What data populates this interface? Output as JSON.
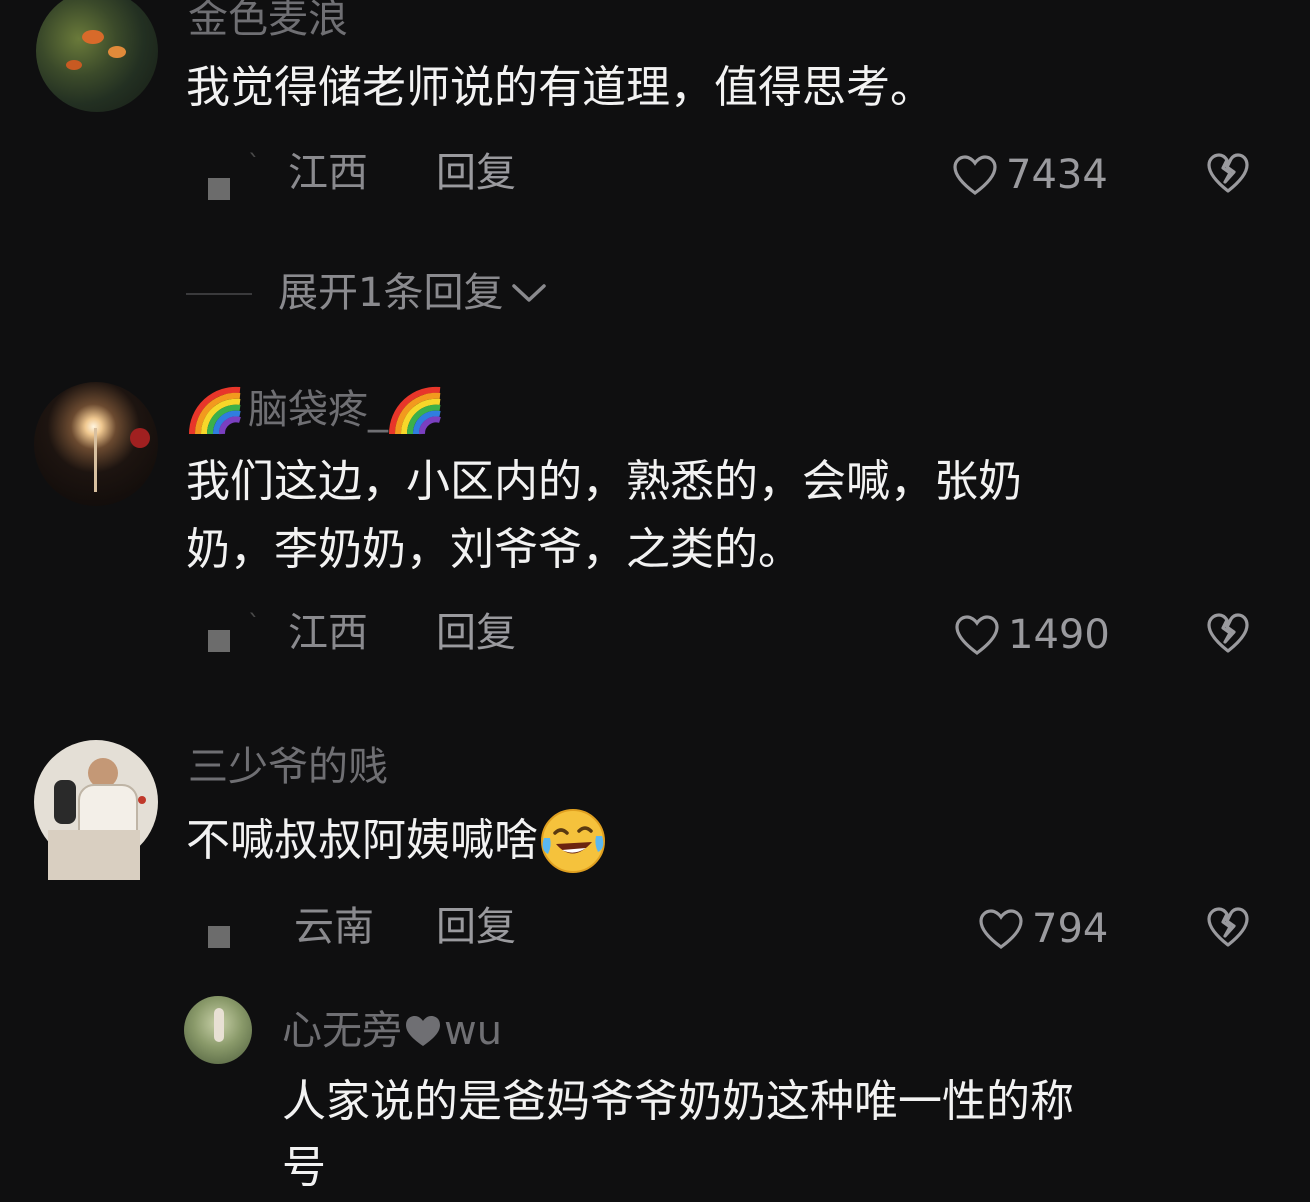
{
  "comments": [
    {
      "username": "金色麦浪",
      "text": "我觉得储老师说的有道理，值得思考。",
      "location": "江西",
      "reply_label": "回复",
      "likes": "7434"
    },
    {
      "username": "脑袋疼_",
      "text_line1": "我们这边，小区内的，熟悉的，会喊，张奶",
      "text_line2": "奶，李奶奶，刘爷爷，之类的。",
      "location": "江西",
      "reply_label": "回复",
      "likes": "1490"
    },
    {
      "username": "三少爷的贱",
      "text": "不喊叔叔阿姨喊啥",
      "location": "云南",
      "reply_label": "回复",
      "likes": "794"
    }
  ],
  "expand_replies": "展开1条回复",
  "reply": {
    "username_prefix": "心无旁",
    "username_suffix": "wu",
    "text_line1": "人家说的是爸妈爷爷奶奶这种唯一性的称",
    "text_line2": "号"
  },
  "colors": {
    "background": "#0f0f10",
    "text": "#f2f2f2",
    "muted": "#8a8a8e"
  },
  "icons": [
    "heart-outline-icon",
    "heart-broken-icon",
    "chevron-down-icon",
    "rainbow-emoji",
    "laughing-crying-emoji"
  ]
}
